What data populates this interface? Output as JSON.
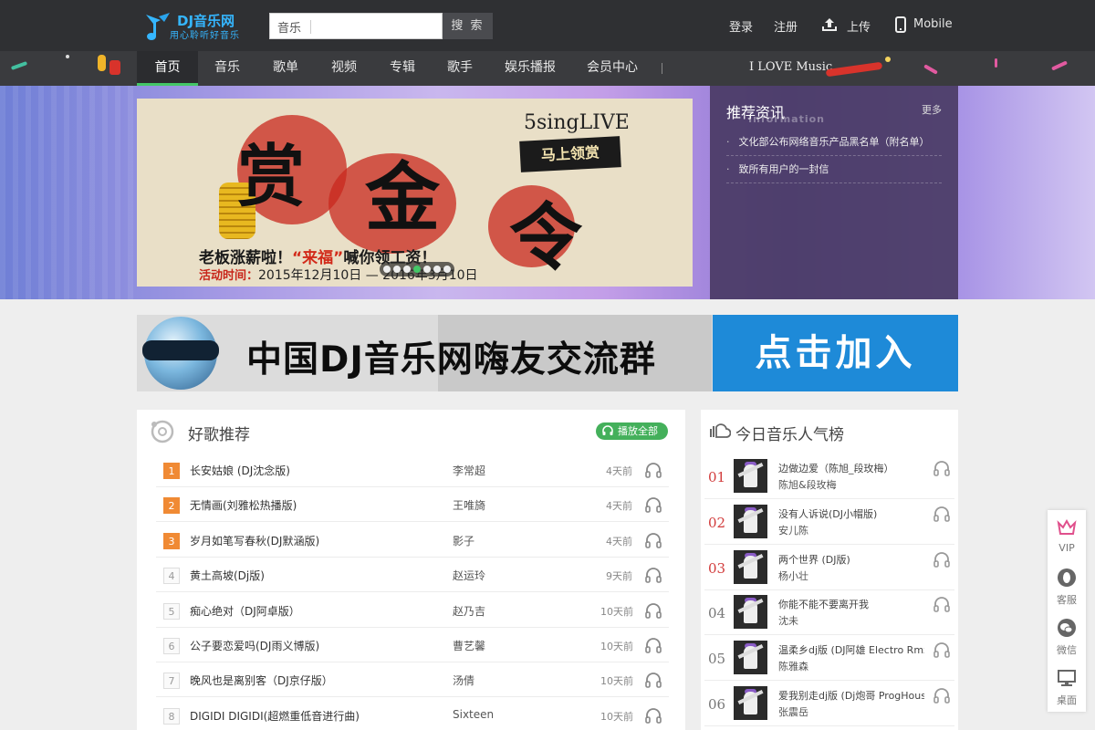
{
  "header": {
    "logo": {
      "title": "DJ音乐网",
      "slogan": "用心聆听好音乐"
    },
    "search": {
      "category": "音乐",
      "placeholder": "",
      "button": "搜 索"
    },
    "links": {
      "login": "登录",
      "register": "注册",
      "upload": "上传",
      "mobile": "Mobile"
    }
  },
  "nav": {
    "items": [
      "首页",
      "音乐",
      "歌单",
      "视频",
      "专辑",
      "歌手",
      "娱乐播报",
      "会员中心"
    ],
    "active_index": 0,
    "separator": "|",
    "tagline": "I LOVE Music"
  },
  "banner": {
    "characters": [
      "赏",
      "金",
      "令"
    ],
    "event": "5singLIVE",
    "claim": "马上领赏",
    "slogan_a": "老板涨薪啦！",
    "slogan_b": "“来福”",
    "slogan_c": "喊你领工资！",
    "date_label": "活动时间：",
    "date_text": "2015年12月10日 — 2016年3月10日",
    "slides": 7,
    "active_slide": 3
  },
  "news": {
    "title": "推荐资讯",
    "subtitle": "Information",
    "more": "更多",
    "items": [
      "文化部公布网络音乐产品黑名单（附名单）",
      "致所有用户的一封信"
    ]
  },
  "promo": {
    "text": "中国DJ音乐网嗨友交流群",
    "join": "点击加入"
  },
  "recommend": {
    "title": "好歌推荐",
    "play_all": "播放全部",
    "songs": [
      {
        "rank": "1",
        "name": "长安姑娘 (DJ沈念版)",
        "artist": "李常超",
        "time": "4天前"
      },
      {
        "rank": "2",
        "name": "无情画(刘雅松热播版)",
        "artist": "王唯旖",
        "time": "4天前"
      },
      {
        "rank": "3",
        "name": "岁月如笔写春秋(DJ默涵版)",
        "artist": "影子",
        "time": "4天前"
      },
      {
        "rank": "4",
        "name": "黄土高坡(Dj版)",
        "artist": "赵运玲",
        "time": "9天前"
      },
      {
        "rank": "5",
        "name": "痴心绝对（DJ阿卓版）",
        "artist": "赵乃吉",
        "time": "10天前"
      },
      {
        "rank": "6",
        "name": "公子要恋爱吗(DJ雨义博版)",
        "artist": "曹艺馨",
        "time": "10天前"
      },
      {
        "rank": "7",
        "name": "晚风也是离别客（DJ京仔版）",
        "artist": "汤倩",
        "time": "10天前"
      },
      {
        "rank": "8",
        "name": "DIGIDI DIGIDI(超燃重低音进行曲)",
        "artist": "Sixteen",
        "time": "10天前"
      }
    ]
  },
  "chart": {
    "title": "今日音乐人气榜",
    "items": [
      {
        "num": "01",
        "name": "边做边爱（陈旭_段玫梅）",
        "artist": "陈旭&段玫梅"
      },
      {
        "num": "02",
        "name": "没有人诉说(DJ小帽版)",
        "artist": "安儿陈"
      },
      {
        "num": "03",
        "name": "两个世界 (DJ版)",
        "artist": "杨小壮"
      },
      {
        "num": "04",
        "name": "你能不能不要离开我",
        "artist": "沈未"
      },
      {
        "num": "05",
        "name": "温柔乡dj版 (DJ阿雄 Electro Rmx",
        "artist": "陈雅森"
      },
      {
        "num": "06",
        "name": "爱我别走dj版 (Dj炮哥 ProgHouse",
        "artist": "张震岳"
      }
    ]
  },
  "sidebar": {
    "vip": "VIP",
    "service": "客服",
    "wechat": "微信",
    "desktop": "桌面"
  },
  "colors": {
    "accent_green": "#44c767",
    "rank_orange": "#f08a34",
    "chart_red": "#d23c3c",
    "promo_blue": "#1e8ad8",
    "header_bg": "#2f3033"
  }
}
